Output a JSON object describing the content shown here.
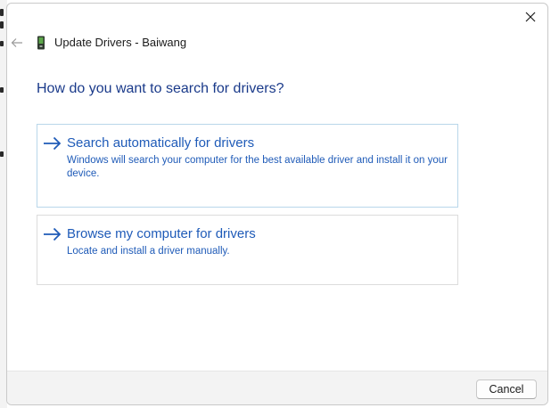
{
  "window": {
    "title": "Update Drivers - Baiwang",
    "close_icon": "close-icon",
    "back_icon": "back-arrow-icon",
    "device_icon": "device-icon"
  },
  "main": {
    "heading": "How do you want to search for drivers?",
    "options": [
      {
        "title": "Search automatically for drivers",
        "description": "Windows will search your computer for the best available driver and install it on your device.",
        "icon": "arrow-right-icon"
      },
      {
        "title": "Browse my computer for drivers",
        "description": "Locate and install a driver manually.",
        "icon": "arrow-right-icon"
      }
    ]
  },
  "footer": {
    "cancel_label": "Cancel"
  },
  "colors": {
    "link_blue": "#1f5bb8",
    "heading_blue": "#1a3a8a",
    "selected_border": "#b9d7ea",
    "footer_bg": "#f3f3f3"
  }
}
